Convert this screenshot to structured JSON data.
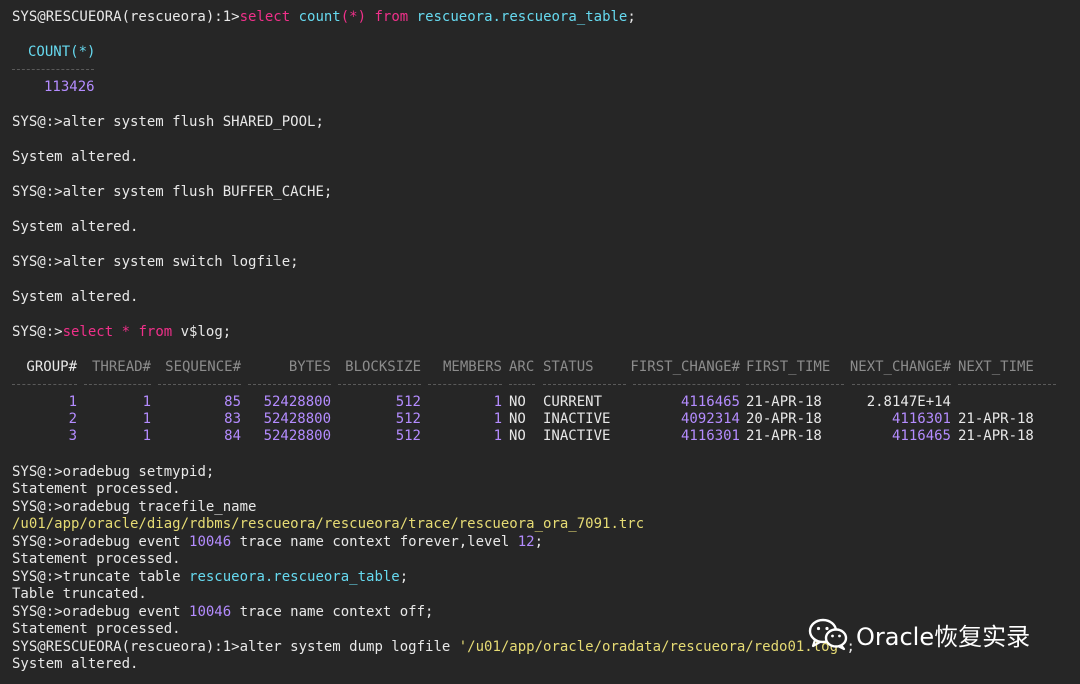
{
  "prompt_full": "SYS@RESCUEORA(rescueora):1>",
  "prompt_short": "SYS@:>",
  "q1": {
    "kw1": "select",
    "fn": "count",
    "op": "(*)",
    "kw2": "from",
    "obj": "rescueora.rescueora_table",
    "end": ";"
  },
  "count_header": "COUNT(*)",
  "count_value": "113426",
  "cmd_flush_shared": "alter system flush SHARED_POOL;",
  "cmd_flush_buffer": "alter system flush BUFFER_CACHE;",
  "cmd_switch": "alter system switch logfile;",
  "system_altered": "System altered.",
  "q2": {
    "kw1": "select",
    "star": "*",
    "kw2": "from",
    "obj": "v$log;"
  },
  "log_table": {
    "headers": [
      "GROUP#",
      "THREAD#",
      "SEQUENCE#",
      "BYTES",
      "BLOCKSIZE",
      "MEMBERS",
      "ARC",
      "STATUS",
      "FIRST_CHANGE#",
      "FIRST_TIME",
      "NEXT_CHANGE#",
      "NEXT_TIME"
    ],
    "rows": [
      [
        "1",
        "1",
        "85",
        "52428800",
        "512",
        "1",
        "NO",
        "CURRENT",
        "4116465",
        "21-APR-18",
        "2.8147E+14",
        ""
      ],
      [
        "2",
        "1",
        "83",
        "52428800",
        "512",
        "1",
        "NO",
        "INACTIVE",
        "4092314",
        "20-APR-18",
        "4116301",
        "21-APR-18"
      ],
      [
        "3",
        "1",
        "84",
        "52428800",
        "512",
        "1",
        "NO",
        "INACTIVE",
        "4116301",
        "21-APR-18",
        "4116465",
        "21-APR-18"
      ]
    ]
  },
  "cmd_setmypid": "oradebug setmypid;",
  "statement_processed": "Statement processed.",
  "cmd_tracefile": "oradebug tracefile_name",
  "trace_path": "/u01/app/oracle/diag/rdbms/rescueora/rescueora/trace/rescueora_ora_7091.trc",
  "event_on": {
    "pre": "oradebug event ",
    "num": "10046",
    "mid": " trace name context forever,level ",
    "lvl": "12",
    "end": ";"
  },
  "truncate": {
    "pre": "truncate table ",
    "obj": "rescueora.rescueora_table",
    "end": ";"
  },
  "table_truncated": "Table truncated.",
  "event_off": {
    "pre": "oradebug event ",
    "num": "10046",
    "end": " trace name context off;"
  },
  "dump": {
    "pre": "alter system dump logfile ",
    "path": "'/u01/app/oracle/oradata/rescueora/redo01.log'",
    "end": ";"
  },
  "watermark": "Oracle恢复实录",
  "colors": {
    "background": "#262626",
    "text": "#e8e8e8",
    "keyword": "#f0308a",
    "number": "#b48cff",
    "string": "#e6db74",
    "header": "#66d9ef"
  }
}
